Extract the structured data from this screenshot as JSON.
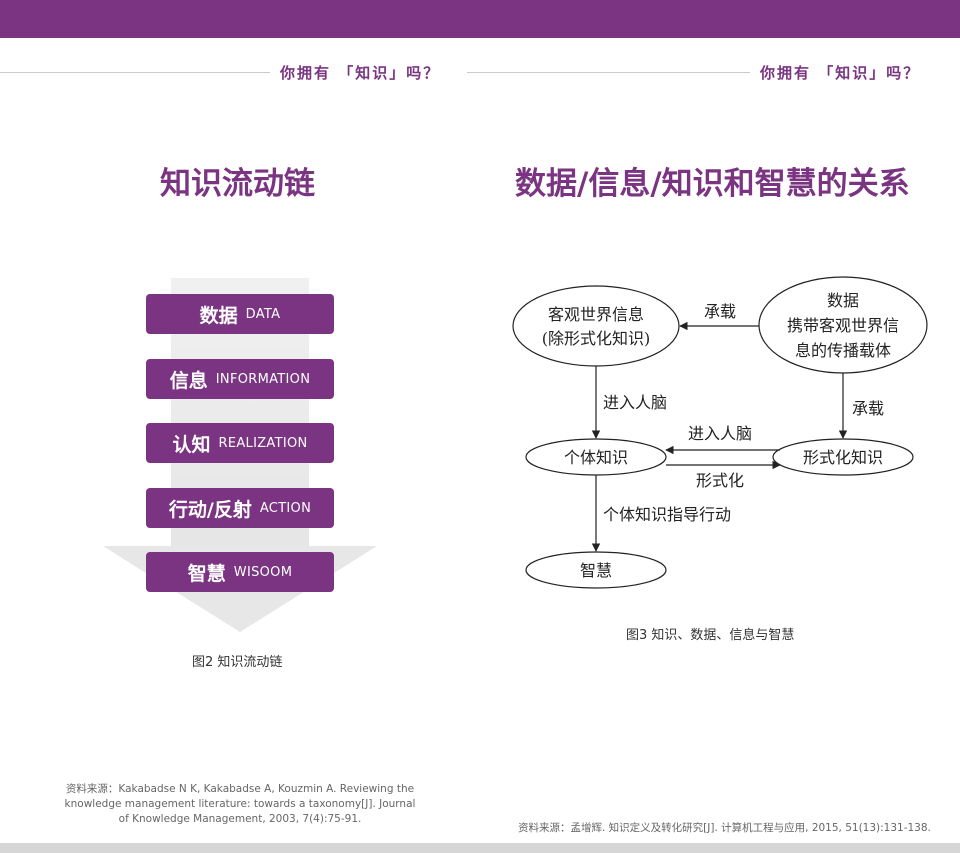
{
  "header": {
    "left_title": "你拥有 「知识」吗？",
    "right_title": "你拥有 「知识」吗？"
  },
  "left": {
    "title": "知识流动链",
    "chain": [
      {
        "cn": "数据",
        "en": "DATA"
      },
      {
        "cn": "信息",
        "en": "INFORMATION"
      },
      {
        "cn": "认知",
        "en": "REALIZATION"
      },
      {
        "cn": "行动/反射",
        "en": "ACTION"
      },
      {
        "cn": "智慧",
        "en": "WISOOM"
      }
    ],
    "caption": "图2 知识流动链",
    "source_line1": "资料来源：Kakabadse N K, Kakabadse A, Kouzmin A. Reviewing the",
    "source_line2": "knowledge management literature: towards a taxonomy[J]. Journal",
    "source_line3": "of Knowledge Management, 2003, 7(4):75-91."
  },
  "right": {
    "title": "数据/信息/知识和智慧的关系",
    "diagram": {
      "node_objective_line1": "客观世界信息",
      "node_objective_line2": "(除形式化知识)",
      "node_data_line1": "数据",
      "node_data_line2": "携带客观世界信",
      "node_data_line3": "息的传播载体",
      "node_individual": "个体知识",
      "node_formal": "形式化知识",
      "node_wisdom": "智慧",
      "edge_carry_top": "承载",
      "edge_carry_right": "承载",
      "edge_enter_brain_left": "进入人脑",
      "edge_enter_brain_mid": "进入人脑",
      "edge_formalize": "形式化",
      "edge_guide": "个体知识指导行动"
    },
    "caption": "图3  知识、数据、信息与智慧",
    "source": "资料来源：孟增辉. 知识定义及转化研究[J]. 计算机工程与应用, 2015, 51(13):131-138."
  },
  "colors": {
    "brand_purple": "#7a3482",
    "footer_gray": "#d6d6d6"
  }
}
